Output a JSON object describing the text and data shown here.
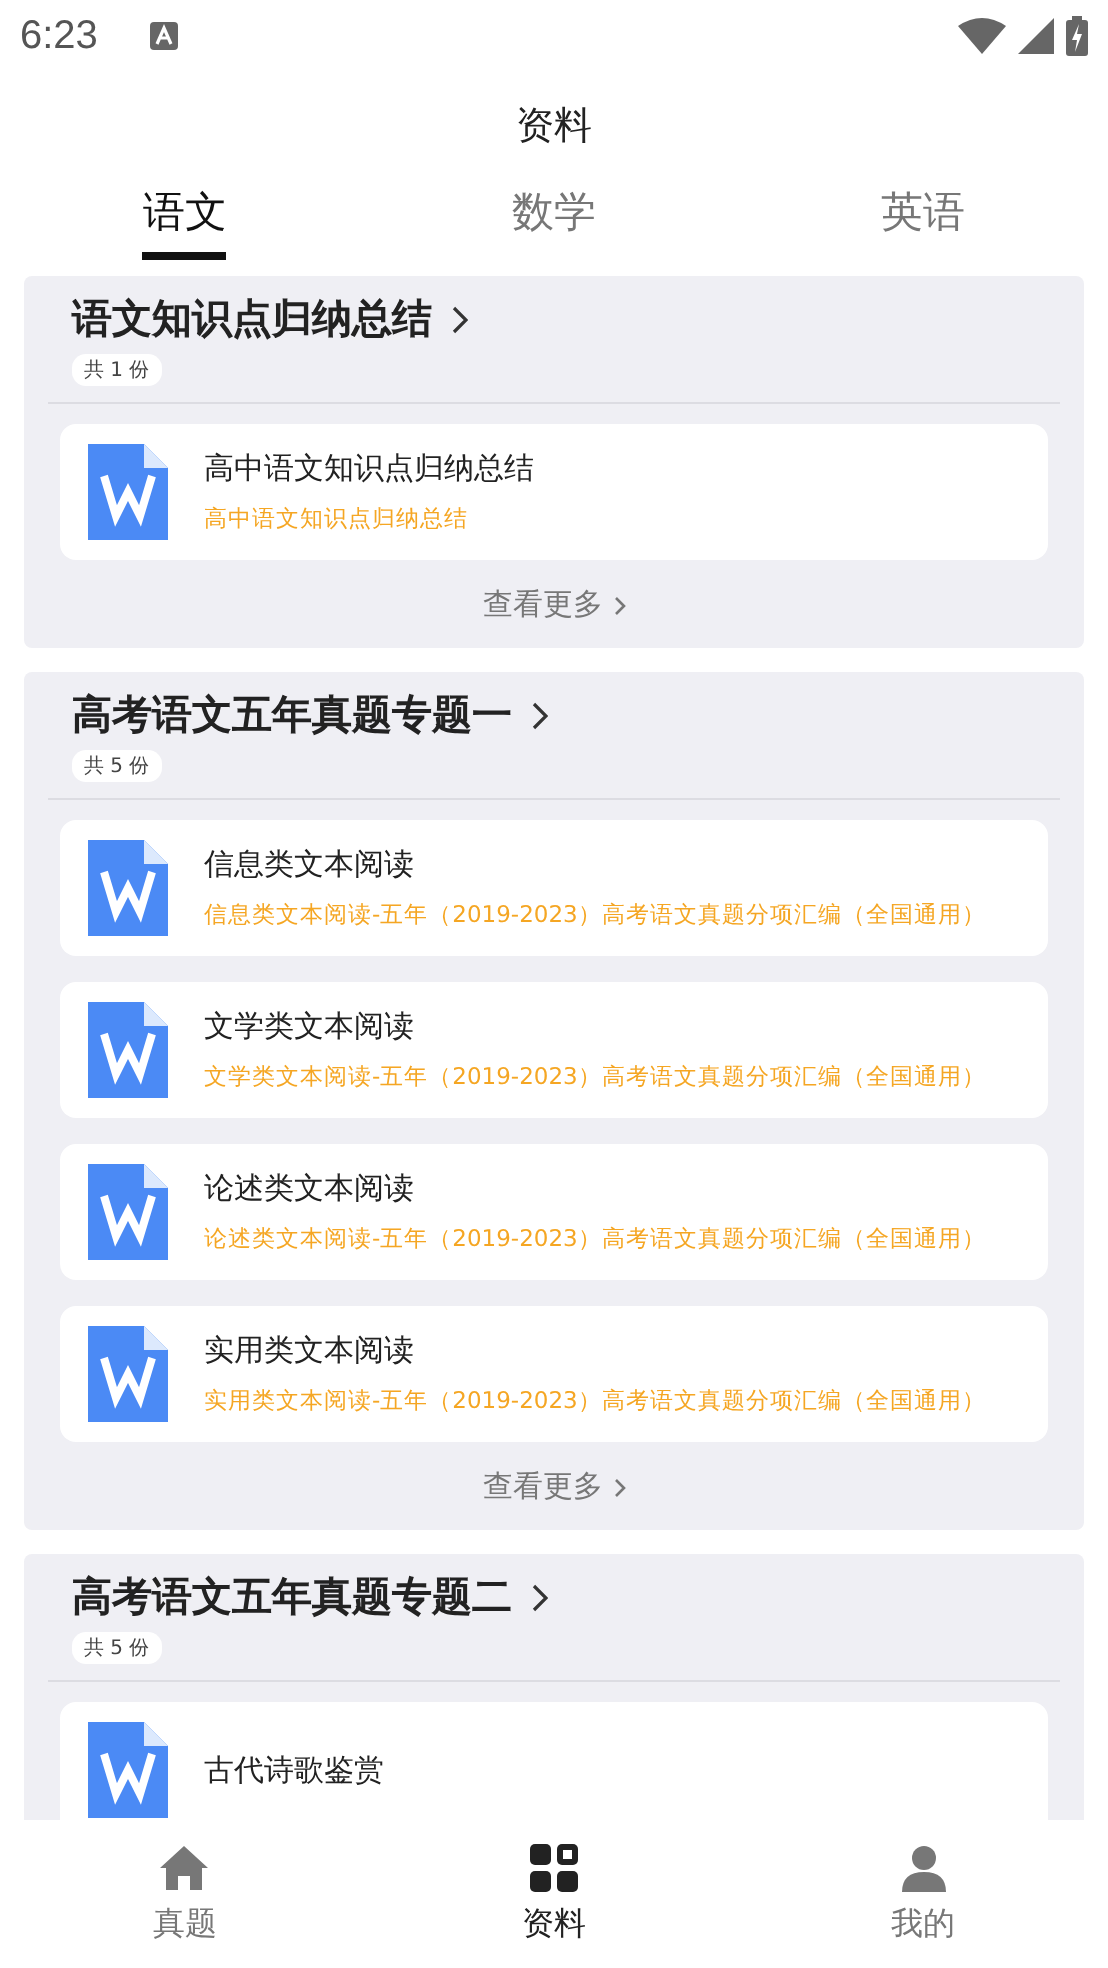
{
  "status_bar": {
    "time": "6:23"
  },
  "header": {
    "title": "资料"
  },
  "tabs": [
    {
      "label": "语文",
      "selected": true
    },
    {
      "label": "数学",
      "selected": false
    },
    {
      "label": "英语",
      "selected": false
    }
  ],
  "sections": [
    {
      "title": "语文知识点归纳总结",
      "count": "共 1 份",
      "more": "查看更多",
      "items": [
        {
          "title": "高中语文知识点归纳总结",
          "subtitle": "高中语文知识点归纳总结"
        }
      ]
    },
    {
      "title": "高考语文五年真题专题一",
      "count": "共 5 份",
      "more": "查看更多",
      "items": [
        {
          "title": "信息类文本阅读",
          "subtitle": "信息类文本阅读-五年（2019-2023）高考语文真题分项汇编（全国通用）"
        },
        {
          "title": "文学类文本阅读",
          "subtitle": "文学类文本阅读-五年（2019-2023）高考语文真题分项汇编（全国通用）"
        },
        {
          "title": "论述类文本阅读",
          "subtitle": "论述类文本阅读-五年（2019-2023）高考语文真题分项汇编（全国通用）"
        },
        {
          "title": "实用类文本阅读",
          "subtitle": "实用类文本阅读-五年（2019-2023）高考语文真题分项汇编（全国通用）"
        }
      ]
    },
    {
      "title": "高考语文五年真题专题二",
      "count": "共 5 份",
      "items": [
        {
          "title": "古代诗歌鉴赏"
        }
      ]
    }
  ],
  "bottom_nav": [
    {
      "label": "真题",
      "kind": "home",
      "selected": false
    },
    {
      "label": "资料",
      "kind": "grid",
      "selected": true
    },
    {
      "label": "我的",
      "kind": "person",
      "selected": false
    }
  ]
}
